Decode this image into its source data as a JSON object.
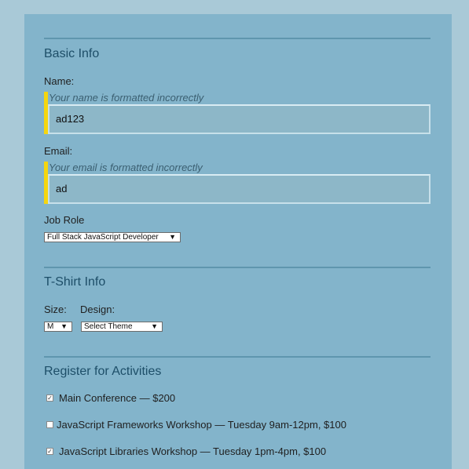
{
  "basic_info": {
    "title": "Basic Info",
    "name_label": "Name:",
    "name_error": "Your name is formatted incorrectly",
    "name_value": "ad123",
    "email_label": "Email:",
    "email_error": "Your email is formatted incorrectly",
    "email_value": "ad",
    "job_role_label": "Job Role",
    "job_role_selected": "Full Stack JavaScript Developer"
  },
  "tshirt_info": {
    "title": "T-Shirt Info",
    "size_label": "Size:",
    "size_selected": "M",
    "design_label": "Design:",
    "design_selected": "Select Theme"
  },
  "activities": {
    "title": "Register for Activities",
    "items": [
      {
        "label": "Main Conference — $200",
        "checked": true
      },
      {
        "label": "JavaScript Frameworks Workshop — Tuesday 9am-12pm, $100",
        "checked": false
      },
      {
        "label": "JavaScript Libraries Workshop — Tuesday 1pm-4pm, $100",
        "checked": true
      }
    ]
  },
  "colors": {
    "page_bg": "#a9c9d7",
    "panel_bg": "#83b4cb",
    "error_accent": "#f5d60f",
    "heading": "#1d4e68"
  },
  "icons": {
    "dropdown": "triangle-down",
    "check": "checkmark"
  }
}
